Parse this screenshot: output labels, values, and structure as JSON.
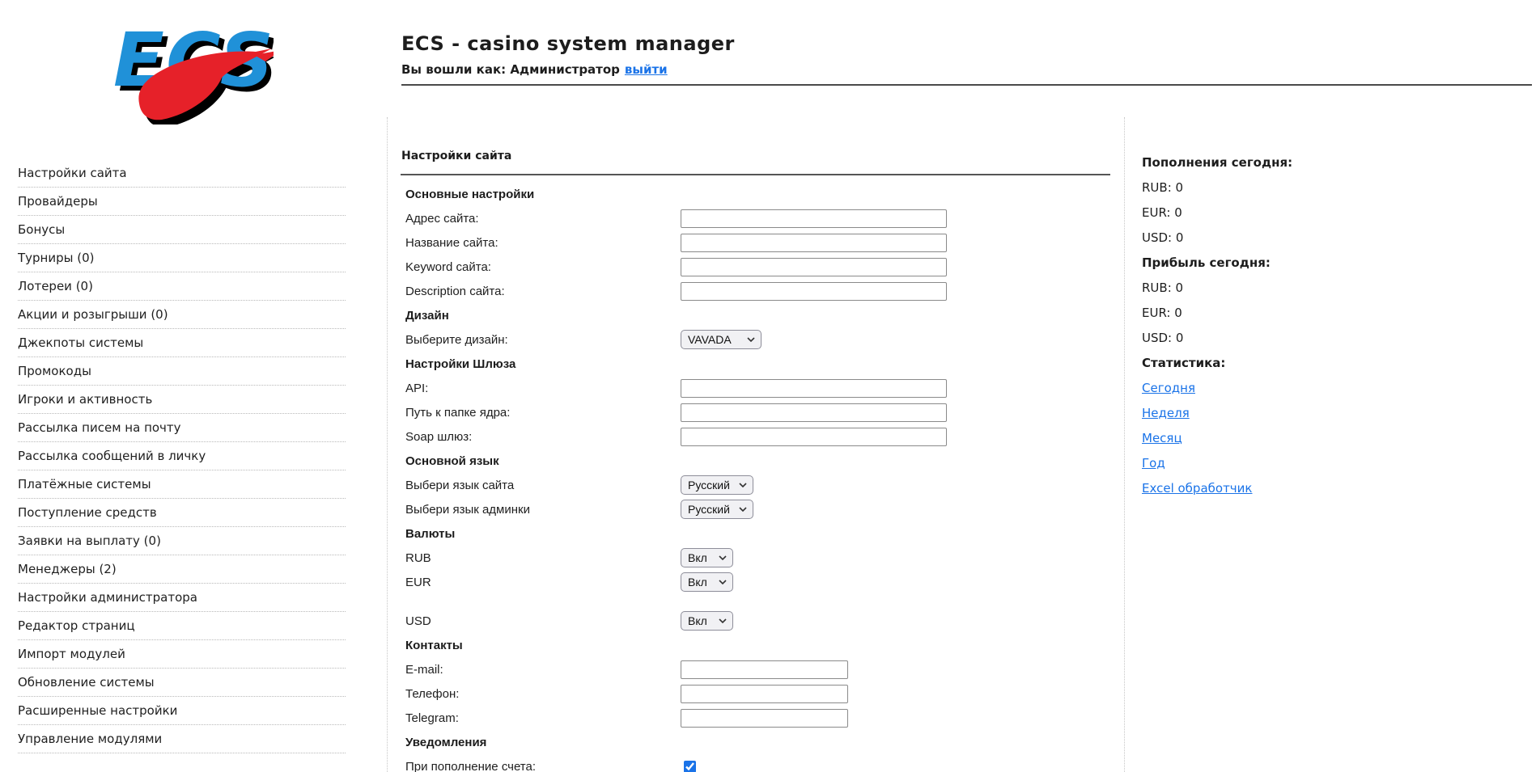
{
  "header": {
    "logo_text": "ECS",
    "title": "ECS - casino system manager",
    "login_prefix": "Вы вошли как: Администратор",
    "logout_label": "выйти"
  },
  "sidebar": {
    "items": [
      "Настройки сайта",
      "Провайдеры",
      "Бонусы",
      "Турниры (0)",
      "Лотереи (0)",
      "Акции и розыгрыши (0)",
      "Джекпоты системы",
      "Промокоды",
      "Игроки и активность",
      "Рассылка писем на почту",
      "Рассылка сообщений в личку",
      "Платёжные системы",
      "Поступление средств",
      "Заявки на выплату (0)",
      "Менеджеры (2)",
      "Настройки администратора",
      "Редактор страниц",
      "Импорт модулей",
      "Обновление системы",
      "Расширенные настройки",
      "Управление модулями"
    ]
  },
  "main": {
    "title": "Настройки сайта",
    "rows": [
      {
        "type": "section",
        "label": "Основные настройки"
      },
      {
        "type": "input",
        "label": "Адрес сайта:",
        "value": ""
      },
      {
        "type": "input",
        "label": "Название сайта:",
        "value": ""
      },
      {
        "type": "input",
        "label": "Keyword сайта:",
        "value": ""
      },
      {
        "type": "input",
        "label": "Description сайта:",
        "value": ""
      },
      {
        "type": "section",
        "label": "Дизайн"
      },
      {
        "type": "select",
        "label": "Выберите дизайн:",
        "value": "VAVADA"
      },
      {
        "type": "section",
        "label": "Настройки Шлюза"
      },
      {
        "type": "input",
        "label": "API:",
        "value": ""
      },
      {
        "type": "input",
        "label": "Путь к папке ядра:",
        "value": ""
      },
      {
        "type": "input",
        "label": "Soap шлюз:",
        "value": ""
      },
      {
        "type": "section",
        "label": "Основной язык"
      },
      {
        "type": "select",
        "label": "Выбери язык сайта",
        "value": "Русский"
      },
      {
        "type": "select",
        "label": "Выбери язык админки",
        "value": "Русский"
      },
      {
        "type": "section",
        "label": "Валюты"
      },
      {
        "type": "select",
        "label": "RUB",
        "value": "Вкл"
      },
      {
        "type": "select",
        "label": "EUR",
        "value": "Вкл"
      },
      {
        "type": "select",
        "label": "USD",
        "value": "Вкл"
      },
      {
        "type": "section",
        "label": "Контакты"
      },
      {
        "type": "input",
        "label": "E-mail:",
        "value": ""
      },
      {
        "type": "input",
        "label": "Телефон:",
        "value": ""
      },
      {
        "type": "input",
        "label": "Telegram:",
        "value": ""
      },
      {
        "type": "section",
        "label": "Уведомления"
      },
      {
        "type": "checkbox",
        "label": "При пополнение счета:",
        "checked": "checked"
      }
    ]
  },
  "stats": {
    "deposits_title": "Пополнения сегодня:",
    "deposits": [
      "RUB: 0",
      "EUR: 0",
      "USD: 0"
    ],
    "profit_title": "Прибыль сегодня:",
    "profit": [
      "RUB: 0",
      "EUR: 0",
      "USD: 0"
    ],
    "stats_title": "Статистика:",
    "links": [
      "Сегодня",
      "Неделя",
      "Месяц",
      "Год",
      "Excel обработчик"
    ]
  },
  "colors": {
    "link_blue": "#1a73e8",
    "logo_blue": "#2091d8",
    "logo_red": "#e62129",
    "rule_dark": "#4a4a4a"
  }
}
